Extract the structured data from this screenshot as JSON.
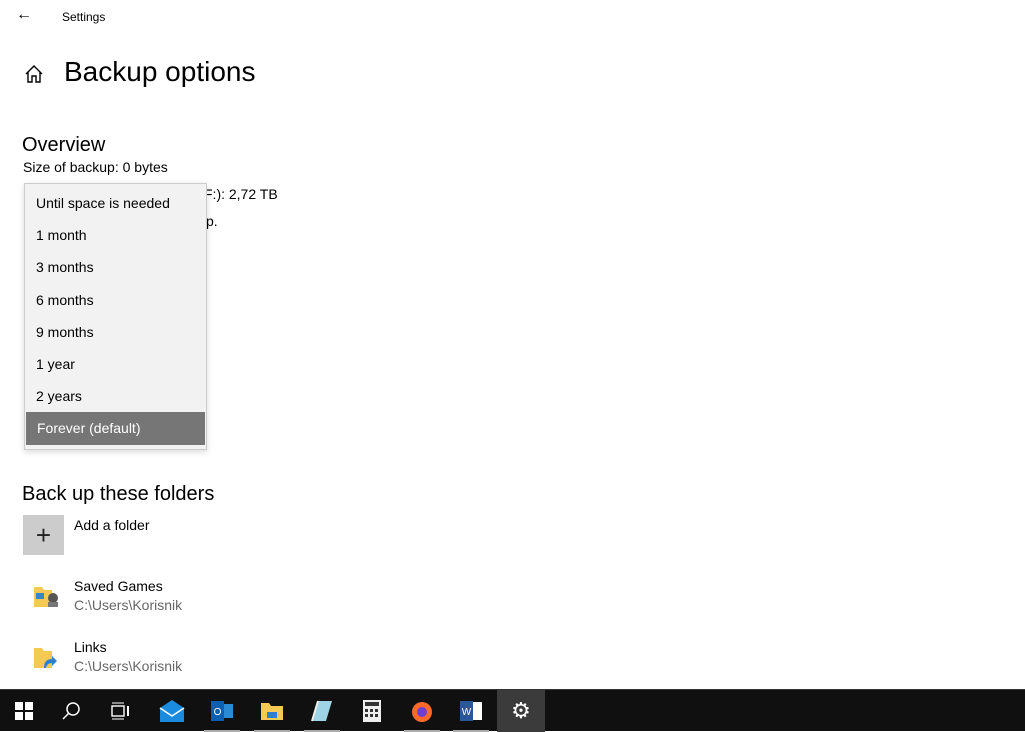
{
  "window": {
    "title": "Settings"
  },
  "page": {
    "title": "Backup options"
  },
  "overview": {
    "heading": "Overview",
    "size": "Size of backup: 0 bytes",
    "space_partial": "F:): 2,72 TB",
    "last_partial": "p."
  },
  "dropdown": {
    "options": [
      "Until space is needed",
      "1 month",
      "3 months",
      "6 months",
      "9 months",
      "1 year",
      "2 years",
      "Forever (default)"
    ],
    "selected": "Forever (default)"
  },
  "folders": {
    "heading": "Back up these folders",
    "add_label": "Add a folder",
    "items": [
      {
        "name": "Saved Games",
        "path": "C:\\Users\\Korisnik"
      },
      {
        "name": "Links",
        "path": "C:\\Users\\Korisnik"
      }
    ]
  },
  "taskbar": {
    "items": [
      "start",
      "search",
      "task-view",
      "mail",
      "outlook",
      "file-explorer",
      "notes",
      "calculator",
      "firefox",
      "word",
      "settings"
    ],
    "active": "settings"
  }
}
